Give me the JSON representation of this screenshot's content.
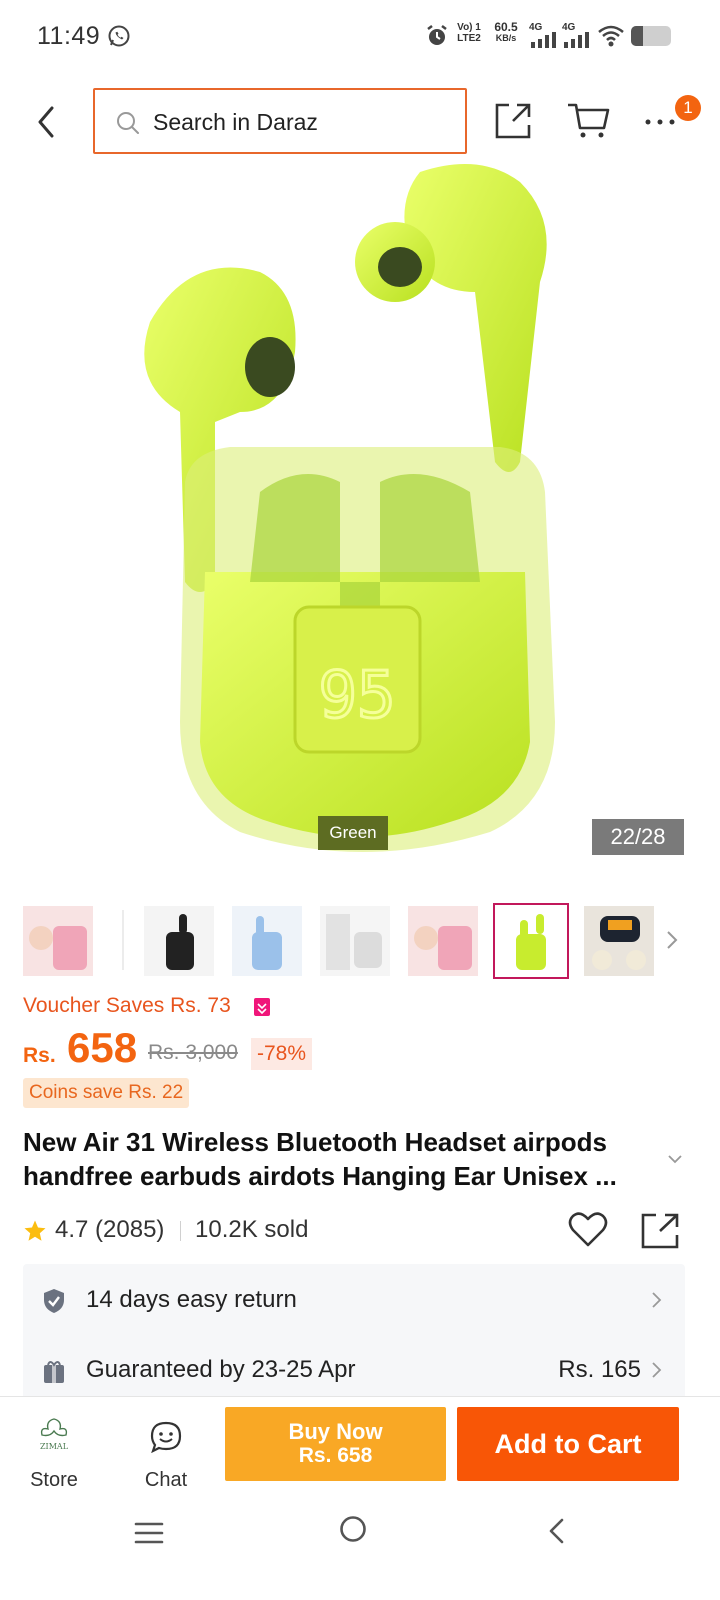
{
  "status_bar": {
    "time": "11:49",
    "volte_line1": "Vo) 1",
    "volte_line2": "LTE2",
    "speed_value": "60.5",
    "speed_unit": "KB/s",
    "net1": "4G",
    "net2": "4G",
    "battery_level": 0.3
  },
  "header": {
    "search_placeholder": "Search in Daraz",
    "more_badge": "1",
    "accent_color": "#e8672b"
  },
  "gallery": {
    "color_label": "Green",
    "counter": "22/28",
    "case_display": "95",
    "thumbnail_count": 7,
    "selected_thumbnail_index": 5
  },
  "pricing": {
    "voucher": "Voucher Saves Rs. 73",
    "currency": "Rs.",
    "price": "658",
    "old_price": "Rs. 3,000",
    "discount": "-78%",
    "coins": "Coins save Rs. 22",
    "price_color": "#f36410"
  },
  "product": {
    "title": "New Air 31 Wireless Bluetooth Headset airpods handfree earbuds airdots Hanging Ear Unisex ...",
    "rating": "4.7 (2085)",
    "sold": "10.2K sold"
  },
  "services": [
    {
      "text": "14 days easy return",
      "value": ""
    },
    {
      "text": "Guaranteed by 23-25 Apr",
      "value": "Rs. 165"
    }
  ],
  "actions": {
    "store_label": "Store",
    "store_logo_text": "ZIMAL",
    "chat_label": "Chat",
    "buy_now_line1": "Buy Now",
    "buy_now_line2": "Rs. 658",
    "add_to_cart": "Add to Cart",
    "buy_now_color": "#f9a825",
    "add_to_cart_color": "#f85606"
  }
}
